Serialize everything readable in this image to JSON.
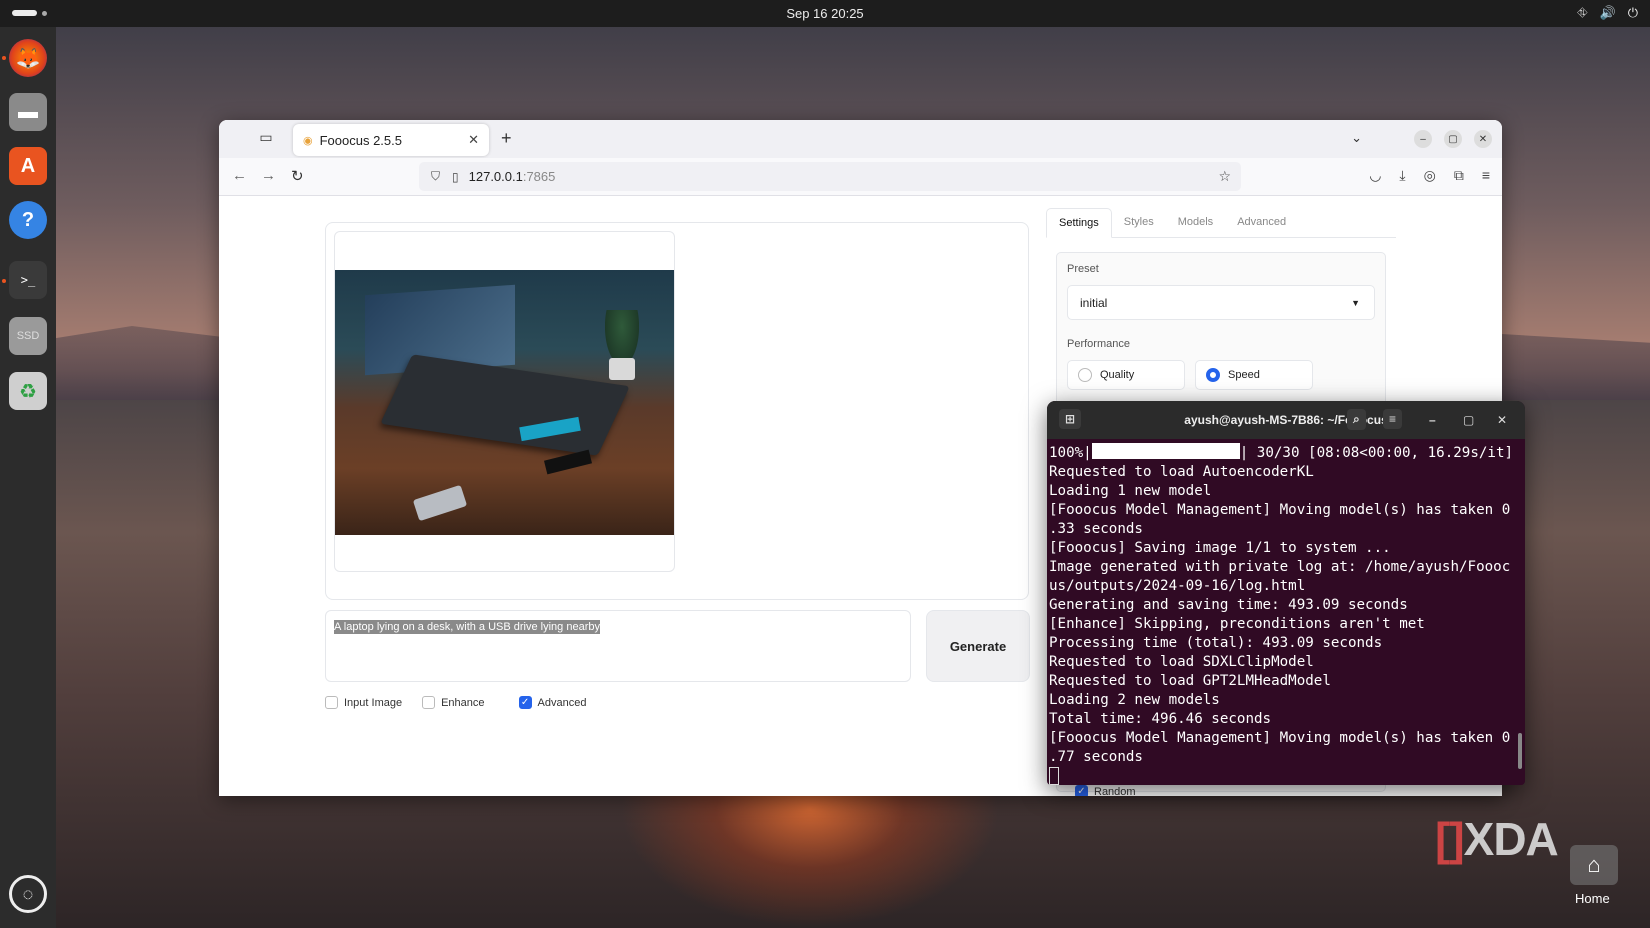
{
  "topbar": {
    "datetime": "Sep 16  20:25"
  },
  "dock": {
    "items": [
      {
        "name": "firefox-icon",
        "glyph": "🦊"
      },
      {
        "name": "files-icon",
        "glyph": "▬"
      },
      {
        "name": "app-center-icon",
        "glyph": "A"
      },
      {
        "name": "help-icon",
        "glyph": "?"
      },
      {
        "name": "terminal-icon",
        "glyph": ">_"
      },
      {
        "name": "drive-icon",
        "glyph": "SSD"
      },
      {
        "name": "trash-icon",
        "glyph": "♻"
      }
    ]
  },
  "browser": {
    "tab_title": "Fooocus 2.5.5",
    "url_host": "127.0.0.1",
    "url_port": ":7865"
  },
  "fooocus": {
    "prompt": "A laptop lying on a desk, with a USB drive lying nearby",
    "generate_label": "Generate",
    "checkboxes": [
      {
        "label": "Input Image",
        "checked": false
      },
      {
        "label": "Enhance",
        "checked": false
      },
      {
        "label": "Advanced",
        "checked": true
      }
    ],
    "side_tabs": [
      "Settings",
      "Styles",
      "Models",
      "Advanced"
    ],
    "preset_label": "Preset",
    "preset_value": "initial",
    "performance_label": "Performance",
    "performance_options": [
      {
        "label": "Quality",
        "selected": false
      },
      {
        "label": "Speed",
        "selected": true
      }
    ],
    "random_label": "Random"
  },
  "terminal": {
    "title": "ayush@ayush-MS-7B86: ~/Fooocus",
    "progress_prefix": "100%|",
    "progress_suffix": "| 30/30 [08:08<00:00, 16.29s/it]",
    "lines": [
      "Requested to load AutoencoderKL",
      "Loading 1 new model",
      "[Fooocus Model Management] Moving model(s) has taken 0",
      ".33 seconds",
      "[Fooocus] Saving image 1/1 to system ...",
      "Image generated with private log at: /home/ayush/Foooc",
      "us/outputs/2024-09-16/log.html",
      "Generating and saving time: 493.09 seconds",
      "[Enhance] Skipping, preconditions aren't met",
      "Processing time (total): 493.09 seconds",
      "Requested to load SDXLClipModel",
      "Requested to load GPT2LMHeadModel",
      "Loading 2 new models",
      "Total time: 496.46 seconds",
      "[Fooocus Model Management] Moving model(s) has taken 0",
      ".77 seconds"
    ]
  },
  "desktop": {
    "watermark": "XDA",
    "home_label": "Home"
  }
}
